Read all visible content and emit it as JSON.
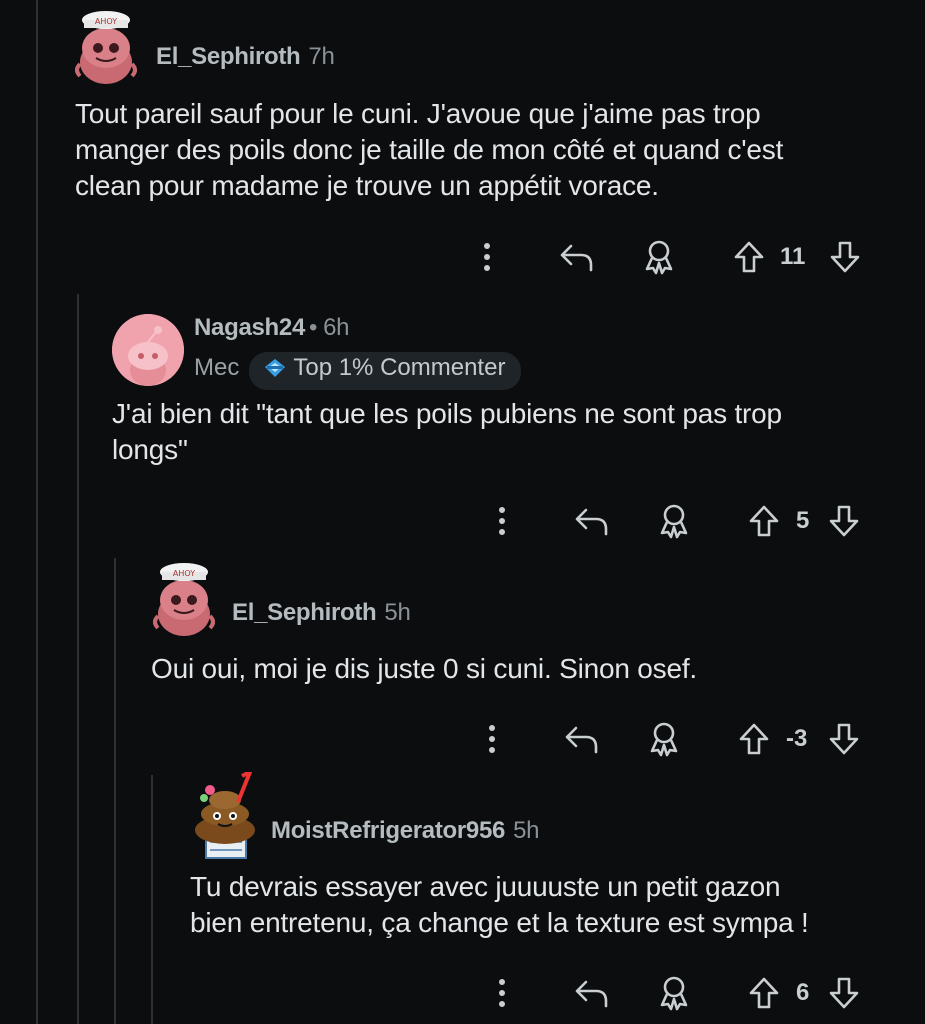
{
  "comments": [
    {
      "author": "El_Sephiroth",
      "time": "7h",
      "body": "Tout pareil sauf pour le cuni. J'avoue que j'aime pas trop\nmanger des poils donc je taille de mon côté et quand c'est\nclean pour madame je trouve un appétit vorace.",
      "score": "11",
      "avatar_hat_text": "AHOY"
    },
    {
      "author": "Nagash24",
      "separator": "•",
      "time": "6h",
      "flair": "Mec",
      "badge": "Top 1% Commenter",
      "body": "J'ai bien dit \"tant que les poils pubiens ne sont pas trop\nlongs\"",
      "score": "5"
    },
    {
      "author": "El_Sephiroth",
      "time": "5h",
      "body": "Oui oui, moi je dis juste 0 si cuni. Sinon osef.",
      "score": "-3",
      "avatar_hat_text": "AHOY"
    },
    {
      "author": "MoistRefrigerator956",
      "time": "5h",
      "body": "Tu devrais essayer avec juuuuste un petit gazon\nbien entretenu, ça change et la texture est sympa !",
      "score": "6"
    }
  ],
  "icons": [
    "more-options-icon",
    "reply-icon",
    "award-icon",
    "upvote-icon",
    "downvote-icon"
  ],
  "colors": {
    "background": "#0b0d0f",
    "thread_line": "#2a3236",
    "text": "#e3e6e8",
    "meta": "#8b9297",
    "badge_bg": "#1e2428",
    "avatar_pink": "#f1a3ad"
  }
}
